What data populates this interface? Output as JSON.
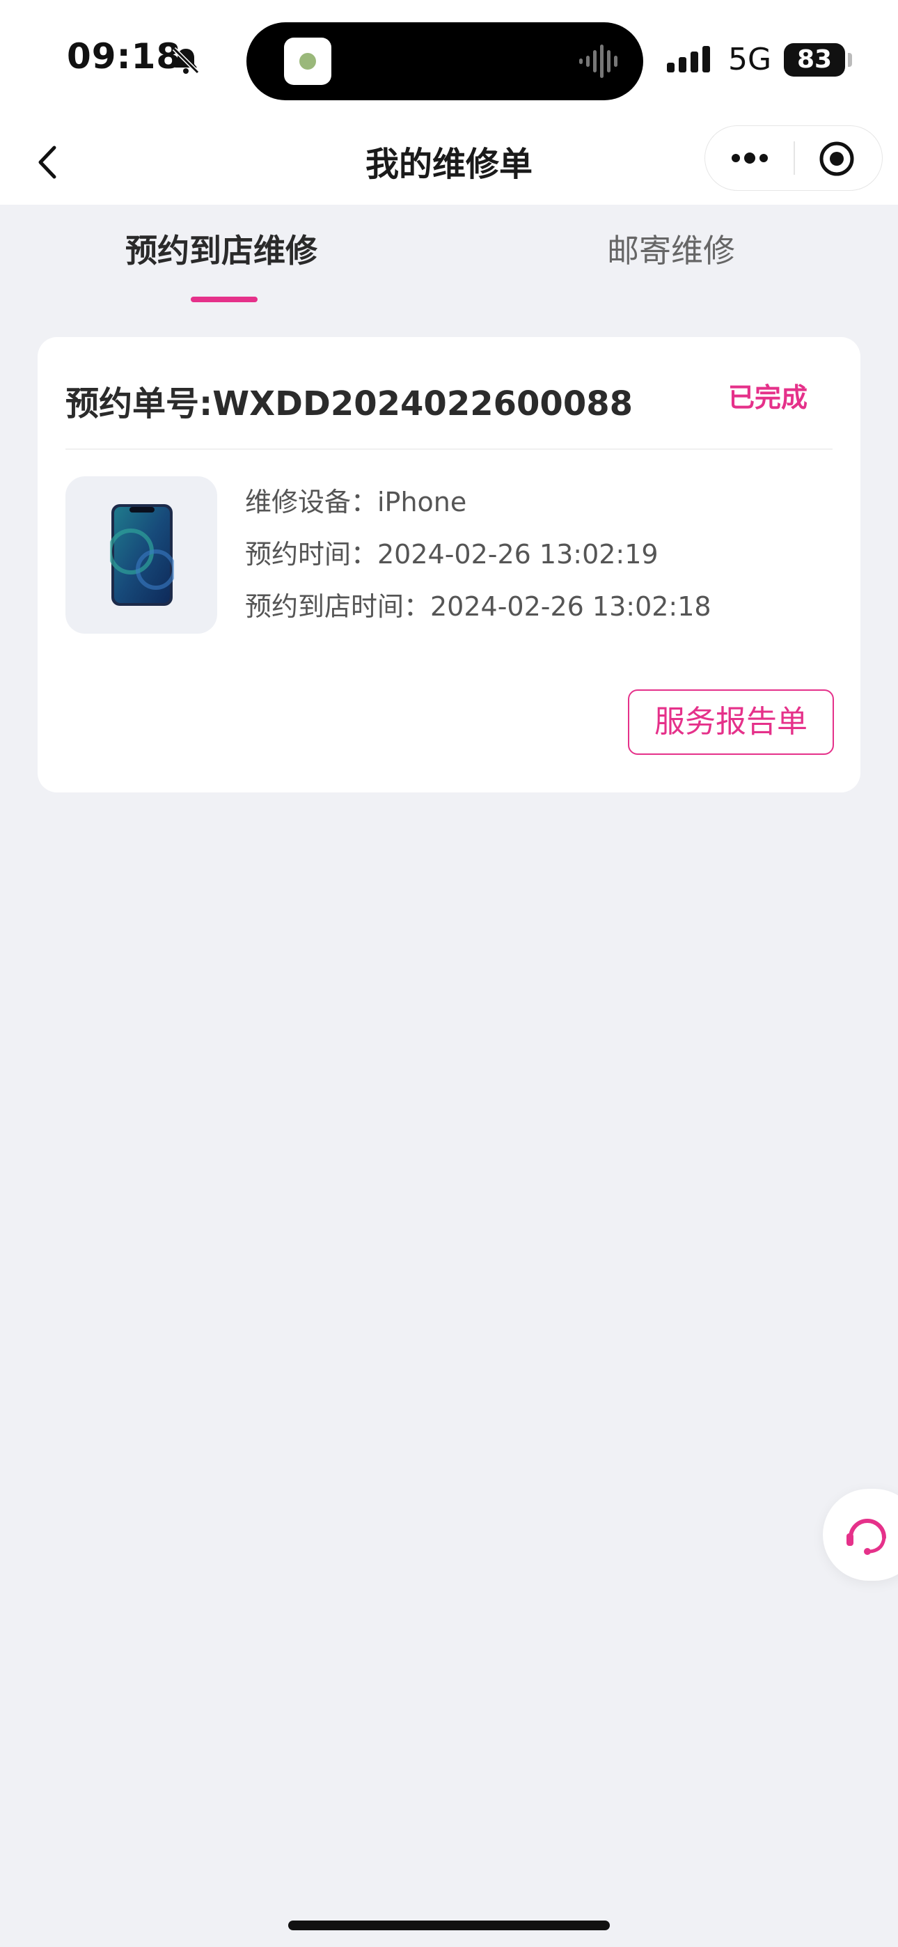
{
  "status_bar": {
    "time": "09:18",
    "network": "5G",
    "battery": "83"
  },
  "nav": {
    "title": "我的维修单"
  },
  "tabs": [
    {
      "label": "预约到店维修",
      "active": true
    },
    {
      "label": "邮寄维修",
      "active": false
    }
  ],
  "order": {
    "number": "预约单号:WXDD2024022600088",
    "status": "已完成",
    "device_line": "维修设备：iPhone",
    "booked_line": "预约时间：2024-02-26 13:02:19",
    "store_line": "预约到店时间：2024-02-26 13:02:18",
    "report_button": "服务报告单"
  },
  "colors": {
    "accent": "#e5318a",
    "background": "#f0f1f5"
  },
  "icons": {
    "back": "chevron-left-icon",
    "more": "more-dots-icon",
    "close": "target-circle-icon",
    "support": "headset-icon",
    "silent": "bell-slash-icon"
  }
}
